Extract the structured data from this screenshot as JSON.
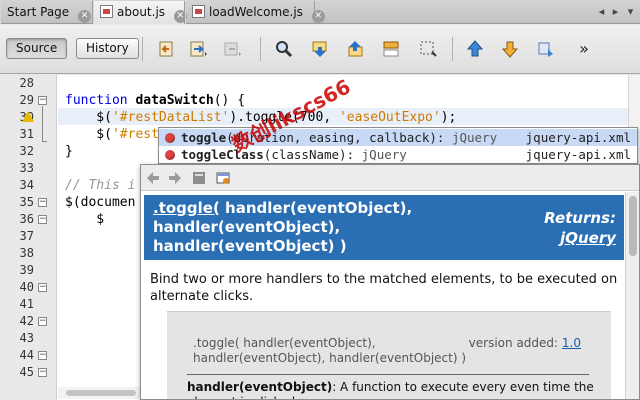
{
  "tabs": [
    {
      "label": "Start Page",
      "active": false,
      "has_file_icon": false
    },
    {
      "label": "about.js",
      "active": true,
      "has_file_icon": true
    },
    {
      "label": "loadWelcome.js",
      "active": false,
      "has_file_icon": true
    }
  ],
  "toolbar": {
    "source_label": "Source",
    "history_label": "History",
    "icons": [
      "back-history-icon",
      "last-edit-icon",
      "forward-disabled-icon",
      "find-icon",
      "find-previous-icon",
      "find-next-icon",
      "toggle-highlight-icon",
      "toggle-rect-selection-icon",
      "previous-bookmark-icon",
      "next-bookmark-icon",
      "toggle-bookmark-icon",
      "more-icon"
    ]
  },
  "editor": {
    "line_numbers": [
      "28",
      "29",
      "30",
      "31",
      "32",
      "33",
      "34",
      "35",
      "36",
      "37",
      "38",
      "39",
      "40",
      "41",
      "42",
      "43",
      "44",
      "45"
    ],
    "code": {
      "l29_kw": "function",
      "l29_fn": "dataSwitch",
      "l29_rest": "() {",
      "l30_pre": "    $(",
      "l30_str1": "'#restDataList'",
      "l30_mid": ").toggle(",
      "l30_num": "700",
      "l30_sep": ", ",
      "l30_str2": "'easeOutExpo'",
      "l30_end": ");",
      "l31_pre": "    $(",
      "l31_str": "'#rest",
      "l32": "}",
      "l34_cm": "// This i",
      "l35": "$(documen",
      "l36": "    $"
    }
  },
  "completion": {
    "items": [
      {
        "name": "toggle",
        "params": "(duration, easing, callback): ",
        "type": "jQuery",
        "source": "jquery-api.xml"
      },
      {
        "name": "toggleClass",
        "params": "(className): ",
        "type": "jQuery",
        "source": "jquery-api.xml"
      }
    ]
  },
  "doc": {
    "signature_link": ".toggle(",
    "signature_rest": " handler(eventObject), handler(eventObject), handler(eventObject) )",
    "returns_label": "Returns:",
    "returns_value": "jQuery",
    "description": "Bind two or more handlers to the matched elements, to be executed on alternate clicks.",
    "box_signature": ".toggle( handler(eventObject), handler(eventObject), handler(eventObject) )",
    "version_label": "version added:",
    "version_value": "1.0",
    "handler_term": "handler(eventObject)",
    "handler_desc": ": A function to execute every even time the element is clicked."
  },
  "watermark": "数创likscs66",
  "colors": {
    "doc_header_bg": "#2a6eb3",
    "selection_bg": "#c7d9f4",
    "keyword": "#0000e6",
    "string": "#ce7b00"
  }
}
